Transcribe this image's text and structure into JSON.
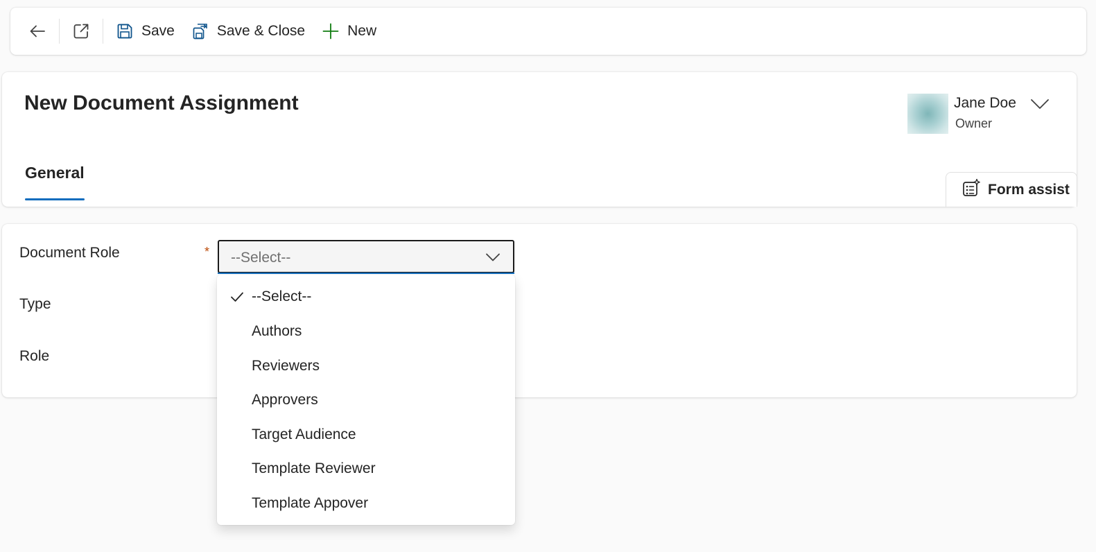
{
  "toolbar": {
    "back_label": "",
    "save_label": "Save",
    "save_close_label": "Save & Close",
    "new_label": "New",
    "new_icon_color": "#107c10"
  },
  "header": {
    "title": "New Document Assignment",
    "owner": {
      "name": "Jane Doe",
      "role": "Owner"
    },
    "tabs": [
      {
        "label": "General",
        "selected": true
      }
    ],
    "form_assist_label": "Form assist"
  },
  "form": {
    "fields": [
      {
        "label": "Document Role",
        "required": true,
        "required_mark": "*",
        "value": "--Select--"
      },
      {
        "label": "Type"
      },
      {
        "label": "Role"
      }
    ]
  },
  "dropdown": {
    "options": [
      {
        "label": "--Select--",
        "selected": true
      },
      {
        "label": "Authors"
      },
      {
        "label": "Reviewers"
      },
      {
        "label": "Approvers"
      },
      {
        "label": "Target Audience"
      },
      {
        "label": "Template Reviewer"
      },
      {
        "label": "Template Appover"
      }
    ]
  },
  "colors": {
    "accent": "#0f6cbd",
    "required": "#bc4b09",
    "page_background": "#fafafa"
  }
}
